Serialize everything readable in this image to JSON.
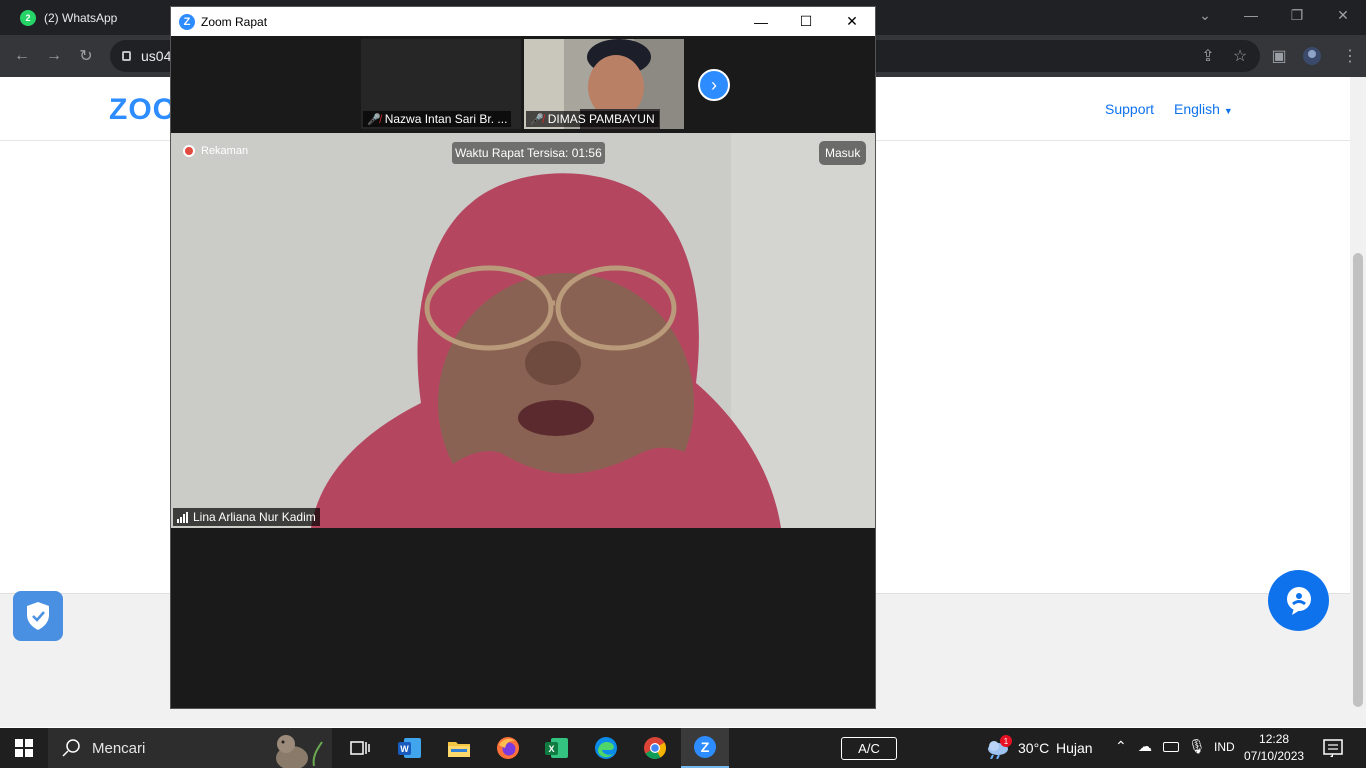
{
  "browser": {
    "tab_title": "(2) WhatsApp",
    "tab_badge": "2",
    "url_text": "us04"
  },
  "zoom_site": {
    "logo_text": "ZOO",
    "support_label": "Support",
    "language_label": "English"
  },
  "meeting": {
    "window_title": "Zoom Rapat",
    "participants": [
      {
        "name": "Nazwa Intan Sari Br. ...",
        "muted": true
      },
      {
        "name": "DIMAS PAMBAYUN",
        "muted": true
      }
    ],
    "recording_label": "Rekaman",
    "timer_text": "Waktu Rapat Tersisa: 01:56",
    "masuk_label": "Masuk",
    "active_speaker": "Lina Arliana Nur Kadim"
  },
  "taskbar": {
    "search_placeholder": "Mencari",
    "apps": [
      "task-view",
      "word",
      "file-explorer",
      "firefox",
      "excel",
      "edge",
      "chrome",
      "zoom"
    ],
    "ac_label": "A/C",
    "weather_badge": "1",
    "temperature": "30°C",
    "weather": "Hujan",
    "language": "IND",
    "time": "12:28",
    "date": "07/10/2023"
  },
  "colors": {
    "zoom_blue": "#2d8cff",
    "link_blue": "#0e72ed",
    "taskbar_bg": "#1f1f1f",
    "recording_red": "#e04a3f"
  }
}
